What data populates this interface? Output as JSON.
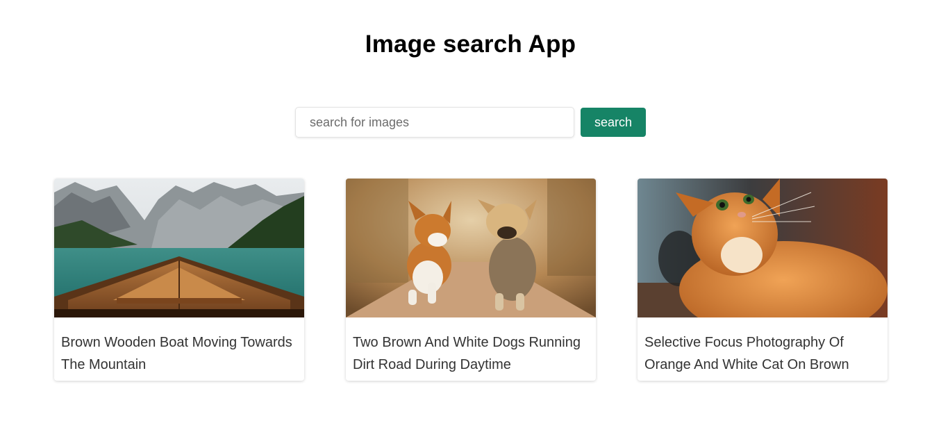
{
  "header": {
    "title": "Image search App"
  },
  "search": {
    "placeholder": "search for images",
    "value": "",
    "button_label": "search"
  },
  "accent_color": "#168466",
  "results": [
    {
      "title": "Brown Wooden Boat Moving Towards The Mountain",
      "image": "mountain-lake-boat"
    },
    {
      "title": "Two Brown And White Dogs Running Dirt Road During Daytime",
      "image": "two-dogs-running"
    },
    {
      "title": "Selective Focus Photography Of Orange And White Cat On Brown Table",
      "image": "orange-cat"
    }
  ]
}
